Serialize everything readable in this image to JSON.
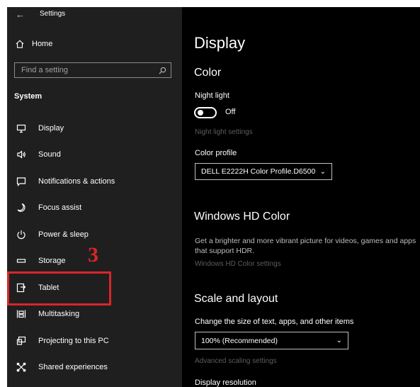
{
  "window": {
    "title": "Settings"
  },
  "sidebar": {
    "home_label": "Home",
    "search_placeholder": "Find a setting",
    "section_label": "System",
    "items": [
      {
        "label": "Display",
        "icon": "monitor-icon"
      },
      {
        "label": "Sound",
        "icon": "speaker-icon"
      },
      {
        "label": "Notifications & actions",
        "icon": "message-icon"
      },
      {
        "label": "Focus assist",
        "icon": "moon-icon"
      },
      {
        "label": "Power & sleep",
        "icon": "power-icon"
      },
      {
        "label": "Storage",
        "icon": "storage-icon"
      },
      {
        "label": "Tablet",
        "icon": "tablet-icon"
      },
      {
        "label": "Multitasking",
        "icon": "multitasking-icon"
      },
      {
        "label": "Projecting to this PC",
        "icon": "projector-icon"
      },
      {
        "label": "Shared experiences",
        "icon": "shared-icon"
      }
    ]
  },
  "annotation": {
    "step_number": "3",
    "color": "#d9262a"
  },
  "main": {
    "page_title": "Display",
    "color": {
      "heading": "Color",
      "night_light_label": "Night light",
      "night_light_state": "Off",
      "night_light_settings_link": "Night light settings",
      "color_profile_label": "Color profile",
      "color_profile_value": "DELL E2222H Color Profile.D6500"
    },
    "hdr": {
      "heading": "Windows HD Color",
      "description": "Get a brighter and more vibrant picture for videos, games and apps that support HDR.",
      "settings_link": "Windows HD Color settings"
    },
    "scale": {
      "heading": "Scale and layout",
      "size_label": "Change the size of text, apps, and other items",
      "size_value": "100% (Recommended)",
      "advanced_link": "Advanced scaling settings",
      "resolution_label": "Display resolution"
    }
  }
}
